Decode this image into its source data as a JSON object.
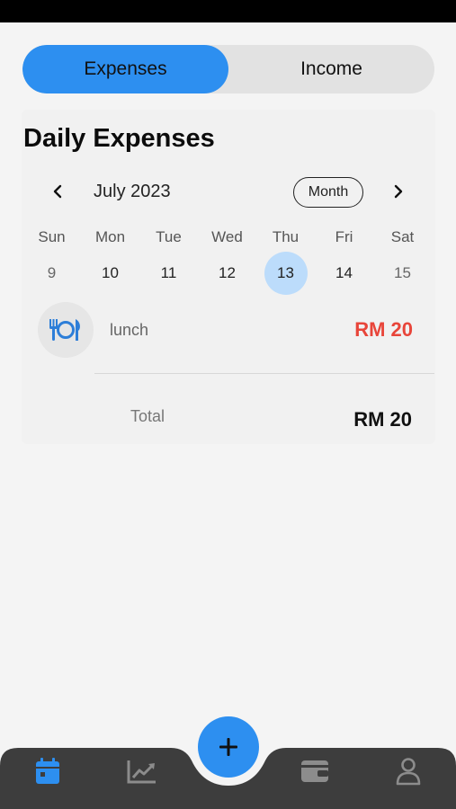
{
  "toggle": {
    "active_label": "Expenses",
    "inactive_label": "Income"
  },
  "page_title": "Daily Expenses",
  "calendar": {
    "month_label": "July 2023",
    "view_mode": "Month",
    "weekdays": [
      "Sun",
      "Mon",
      "Tue",
      "Wed",
      "Thu",
      "Fri",
      "Sat"
    ],
    "days": [
      "9",
      "10",
      "11",
      "12",
      "13",
      "14",
      "15"
    ],
    "selected_day": "13"
  },
  "expenses": [
    {
      "icon": "utensils-icon",
      "name": "lunch",
      "amount": "RM 20"
    }
  ],
  "total": {
    "label": "Total",
    "amount": "RM 20"
  },
  "bottom_nav": {
    "items": [
      "calendar-icon",
      "chart-icon",
      "wallet-icon",
      "profile-icon"
    ],
    "fab_icon": "plus-icon"
  },
  "colors": {
    "accent": "#2d8ff0",
    "selected_day_bg": "#bcdcfb",
    "expense_amount": "#e8453a",
    "nav_bg": "#3d3d3d"
  }
}
